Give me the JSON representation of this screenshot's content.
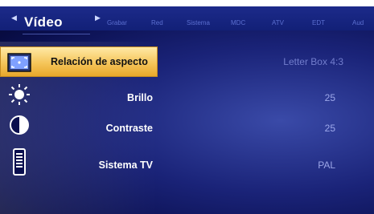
{
  "header": {
    "active_tab": "Vídeo",
    "tabs": [
      "Grabar",
      "Red",
      "Sistema",
      "MDC",
      "ATV",
      "EDT",
      "Aud"
    ],
    "prev_arrow": "◀",
    "next_arrow": "▶"
  },
  "settings": [
    {
      "label": "Relación de aspecto",
      "value": "Letter Box 4:3",
      "icon": "aspect-ratio-icon",
      "selected": true
    },
    {
      "label": "Brillo",
      "value": "25",
      "icon": "brightness-icon",
      "selected": false
    },
    {
      "label": "Contraste",
      "value": "25",
      "icon": "contrast-icon",
      "selected": false
    },
    {
      "label": "Sistema TV",
      "value": "PAL",
      "icon": "tv-system-icon",
      "selected": false
    }
  ],
  "colors": {
    "accent": "#f5c55a",
    "background": "#0a0f4e",
    "tabbar": "#1c2a8a"
  }
}
